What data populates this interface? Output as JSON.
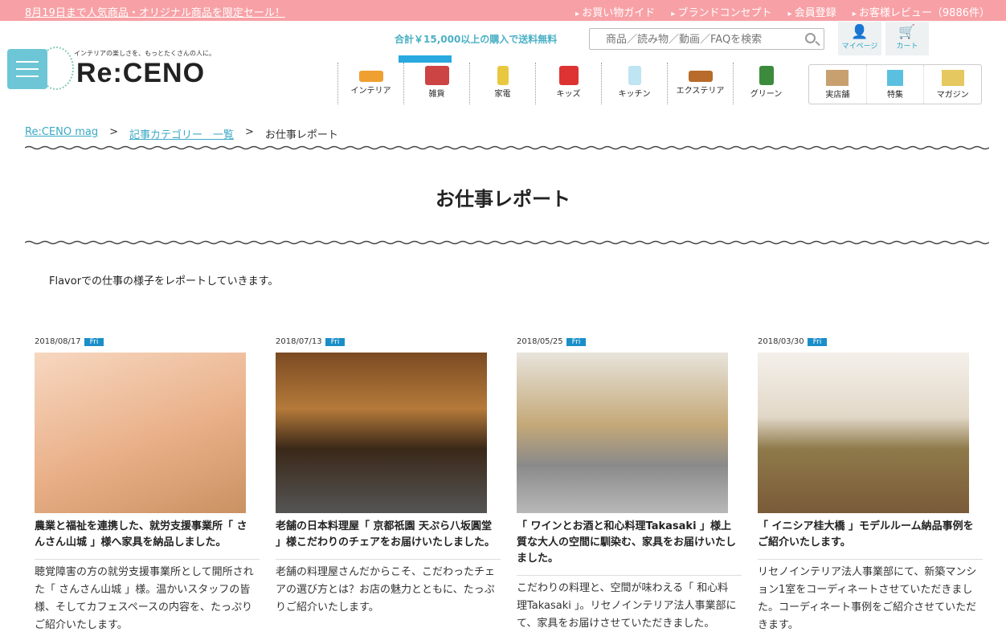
{
  "topbar": {
    "sale": "8月19日まで人気商品・オリジナル商品を限定セール！",
    "links": [
      "お買い物ガイド",
      "ブランドコンセプト",
      "会員登録",
      "お客様レビュー（9886件）"
    ]
  },
  "header": {
    "tagline": "インテリアの楽しさを、もっとたくさんの人に。",
    "logo": "Re:CENO",
    "shipping": "合計￥15,000以上の購入で送料無料",
    "search_placeholder": "商品／読み物／動画／FAQを検索",
    "mypage": "マイページ",
    "cart": "カート"
  },
  "nav": {
    "items": [
      "インテリア",
      "雑貨",
      "家電",
      "キッズ",
      "キッチン",
      "エクステリア",
      "グリーン"
    ],
    "sub": [
      "実店舗",
      "特集",
      "マガジン"
    ]
  },
  "breadcrumb": [
    "Re:CENO mag",
    "記事カテゴリー　一覧",
    "お仕事レポート"
  ],
  "page": {
    "title": "お仕事レポート",
    "intro": "Flavorでの仕事の様子をレポートしていきます。"
  },
  "articles": [
    {
      "date": "2018/08/17",
      "day": "Fri",
      "title": "農業と福祉を連携した、就労支援事業所「 さんさん山城 」様へ家具を納品しました。",
      "desc": "聴覚障害の方の就労支援事業所として開所された「 さんさん山城 」様。温かいスタッフの皆様、そしてカフェスペースの内容を、たっぷりご紹介いたします。"
    },
    {
      "date": "2018/07/13",
      "day": "Fri",
      "title": "老舗の日本料理屋「 京都祇園 天ぷら八坂圓堂 」様こだわりのチェアをお届けいたしました。",
      "desc": "老舗の料理屋さんだからこそ、こだわったチェアの選び方とは？お店の魅力とともに、たっぷりご紹介いたします。"
    },
    {
      "date": "2018/05/25",
      "day": "Fri",
      "title": "「 ワインとお酒と和心料理Takasaki 」様上質な大人の空間に馴染む、家具をお届けいたしました。",
      "desc": "こだわりの料理と、空間が味わえる「 和心料理Takasaki 」。リセノインテリア法人事業部にて、家具をお届けさせていただきました。"
    },
    {
      "date": "2018/03/30",
      "day": "Fri",
      "title": "「 イニシア桂大橋 」モデルルーム納品事例をご紹介いたします。",
      "desc": "リセノインテリア法人事業部にて、新築マンション1室をコーディネートさせていただきました。コーディネート事例をご紹介させていただきます。"
    }
  ]
}
